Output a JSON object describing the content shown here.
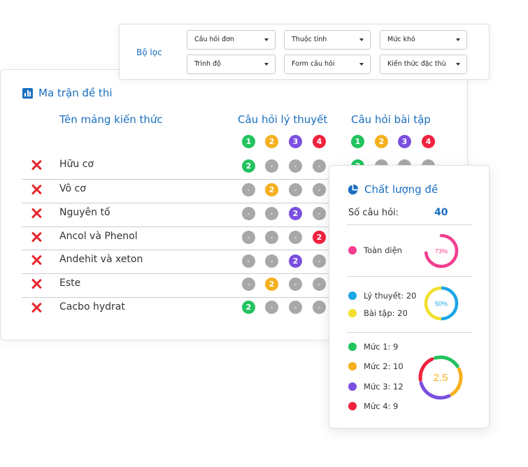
{
  "filter": {
    "label": "Bộ lọc",
    "selects": [
      {
        "value": "Câu hỏi đơn"
      },
      {
        "value": "Thuộc tính"
      },
      {
        "value": "Mức khó"
      },
      {
        "value": "Trình độ"
      },
      {
        "value": "Form câu hỏi"
      },
      {
        "value": "Kiến thức đặc thù"
      }
    ]
  },
  "matrix": {
    "title": "Ma trận đề thi",
    "col_name": "Tên mảng kiến thức",
    "col_theory": "Câu hỏi lý thuyết",
    "col_practice": "Câu hỏi bài tập",
    "levels": [
      "1",
      "2",
      "3",
      "4"
    ],
    "rows": [
      {
        "name": "Hữu cơ",
        "theory": [
          "2",
          "-",
          "-",
          "-"
        ],
        "practice": [
          "2",
          "-",
          "-",
          "-"
        ]
      },
      {
        "name": "Vô cơ",
        "theory": [
          "-",
          "2",
          "-",
          "-"
        ]
      },
      {
        "name": "Nguyên tố",
        "theory": [
          "-",
          "-",
          "2",
          "-"
        ]
      },
      {
        "name": "Ancol và Phenol",
        "theory": [
          "-",
          "-",
          "-",
          "2"
        ]
      },
      {
        "name": "Andehit và xeton",
        "theory": [
          "-",
          "-",
          "2",
          "-"
        ]
      },
      {
        "name": "Este",
        "theory": [
          "-",
          "2",
          "-",
          "-"
        ]
      },
      {
        "name": "Cacbo hydrat",
        "theory": [
          "2",
          "-",
          "-",
          "-"
        ]
      }
    ]
  },
  "quality": {
    "title": "Chất lượng đề",
    "count_label": "Số câu hỏi:",
    "count": "40",
    "comprehensive": {
      "label": "Toàn diện",
      "percent": 73,
      "percent_label": "73%",
      "color": "#f23d8f"
    },
    "types": {
      "theory_label": "Lý thuyết: 20",
      "practice_label": "Bài tập: 20",
      "center": "50%",
      "theory_color": "#1aa6e8",
      "practice_color": "#f2e02c"
    },
    "levels": {
      "center": "2.5",
      "items": [
        {
          "label": "Mức 1: 9",
          "value": 9,
          "color": "#22c35e"
        },
        {
          "label": "Mức 2: 10",
          "value": 10,
          "color": "#f6b01e"
        },
        {
          "label": "Mức 3: 12",
          "value": 12,
          "color": "#7b4fe0"
        },
        {
          "label": "Mức 4: 9",
          "value": 9,
          "color": "#f0223d"
        }
      ]
    }
  },
  "colors": {
    "accent": "#1a6fbf",
    "level_1": "#22c35e",
    "level_2": "#f6b01e",
    "level_3": "#7b4fe0",
    "level_4": "#f0223d",
    "empty": "#a8a8a8",
    "remove": "#e8252c"
  }
}
